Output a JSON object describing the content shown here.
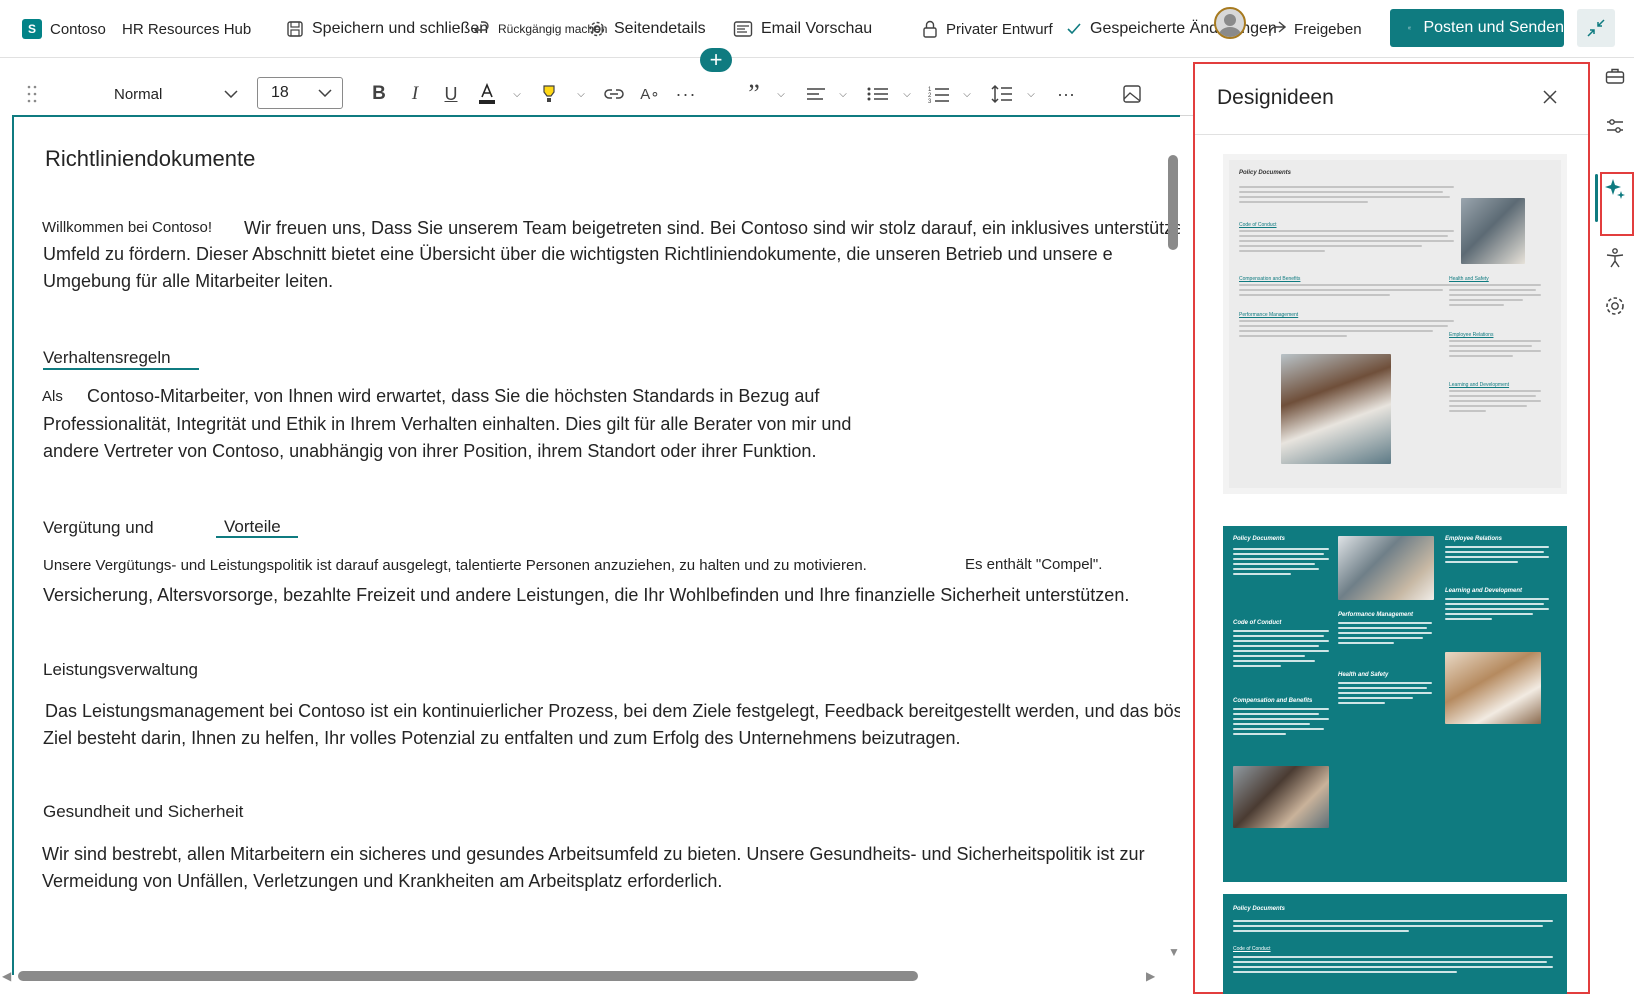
{
  "topbar": {
    "app_name": "Contoso",
    "site_name": "HR Resources Hub",
    "save_close": "Speichern und schließen",
    "undo": "Rückgängig machen",
    "page_details": "Seitendetails",
    "email_preview": "Email Vorschau",
    "private_draft": "Privater Entwurf",
    "saved_changes": "Gespeicherte Änderungen",
    "share": "Freigeben",
    "post_send": "Posten und Senden",
    "add": "+"
  },
  "format": {
    "style": "Normal",
    "size": "18"
  },
  "document": {
    "title": "Richtliniendokumente",
    "welcome_label": "Willkommen bei Contoso!",
    "welcome_line1": "Wir freuen uns, Dass Sie unserem Team beigetreten sind. Bei Contoso sind wir stolz darauf, ein inklusives unterstützendes",
    "welcome_line2": "Umfeld zu fördern. Dieser Abschnitt bietet eine Übersicht über die wichtigsten Richtliniendokumente, die unseren Betrieb und unsere e",
    "welcome_line3": "Umgebung für alle Mitarbeiter leiten.",
    "sections": {
      "conduct": {
        "heading": "Verhaltensregeln",
        "lead": "Als",
        "line1": "Contoso-Mitarbeiter, von Ihnen wird erwartet, dass Sie die höchsten Standards in Bezug auf",
        "line2": "Professionalität, Integrität und Ethik in Ihrem Verhalten einhalten. Dies gilt für alle Berater von mir und",
        "line3": "andere Vertreter von Contoso, unabhängig von ihrer Position, ihrem Standort oder ihrer Funktion."
      },
      "compensation": {
        "heading_a": "Vergütung und",
        "heading_b": "Vorteile",
        "line1": "Unsere Vergütungs- und Leistungspolitik ist darauf ausgelegt, talentierte Personen anzuziehen, zu halten und zu motivieren.",
        "inline_note": "Es enthält \"Compel\".",
        "line2": "Versicherung, Altersvorsorge, bezahlte Freizeit und andere Leistungen, die Ihr Wohlbefinden und Ihre finanzielle Sicherheit unterstützen."
      },
      "performance": {
        "heading": "Leistungsverwaltung",
        "line1": "Das Leistungsmanagement bei Contoso ist ein kontinuierlicher Prozess, bei dem Ziele festgelegt, Feedback bereitgestellt werden, und das böse",
        "line2": "Ziel besteht darin, Ihnen zu helfen, Ihr volles Potenzial zu entfalten und zum Erfolg des Unternehmens beizutragen."
      },
      "health": {
        "heading": "Gesundheit und Sicherheit",
        "line1": "Wir sind bestrebt, allen Mitarbeitern ein sicheres und gesundes Arbeitsumfeld zu bieten. Unsere Gesundheits- und Sicherheitspolitik ist zur",
        "line2": "Vermeidung von Unfällen, Verletzungen und Krankheiten am Arbeitsplatz erforderlich."
      }
    }
  },
  "design_panel": {
    "title": "Designideen",
    "card_labels": {
      "policy": "Policy Documents",
      "conduct": "Code of Conduct",
      "compensation": "Compensation and Benefits",
      "performance": "Performance Management",
      "health": "Health and Safety",
      "relations": "Employee Relations",
      "learning": "Learning and Development"
    }
  },
  "colors": {
    "accent": "#0f7b80",
    "highlight_border": "#e23d3d"
  },
  "icons": [
    "sharepoint-icon",
    "save-icon",
    "undo-icon",
    "gear-icon",
    "email-icon",
    "lock-icon",
    "check-icon",
    "share-icon",
    "post-icon",
    "collapse-icon",
    "drag-icon",
    "bold-icon",
    "italic-icon",
    "underline-icon",
    "font-color-icon",
    "highlight-icon",
    "link-icon",
    "clear-format-icon",
    "more-icon",
    "quote-icon",
    "align-icon",
    "bullets-icon",
    "numbering-icon",
    "line-spacing-icon",
    "image-icon",
    "close-icon",
    "toolbox-icon",
    "sliders-icon",
    "sparkle-icon",
    "accessibility-icon",
    "settings-icon"
  ]
}
